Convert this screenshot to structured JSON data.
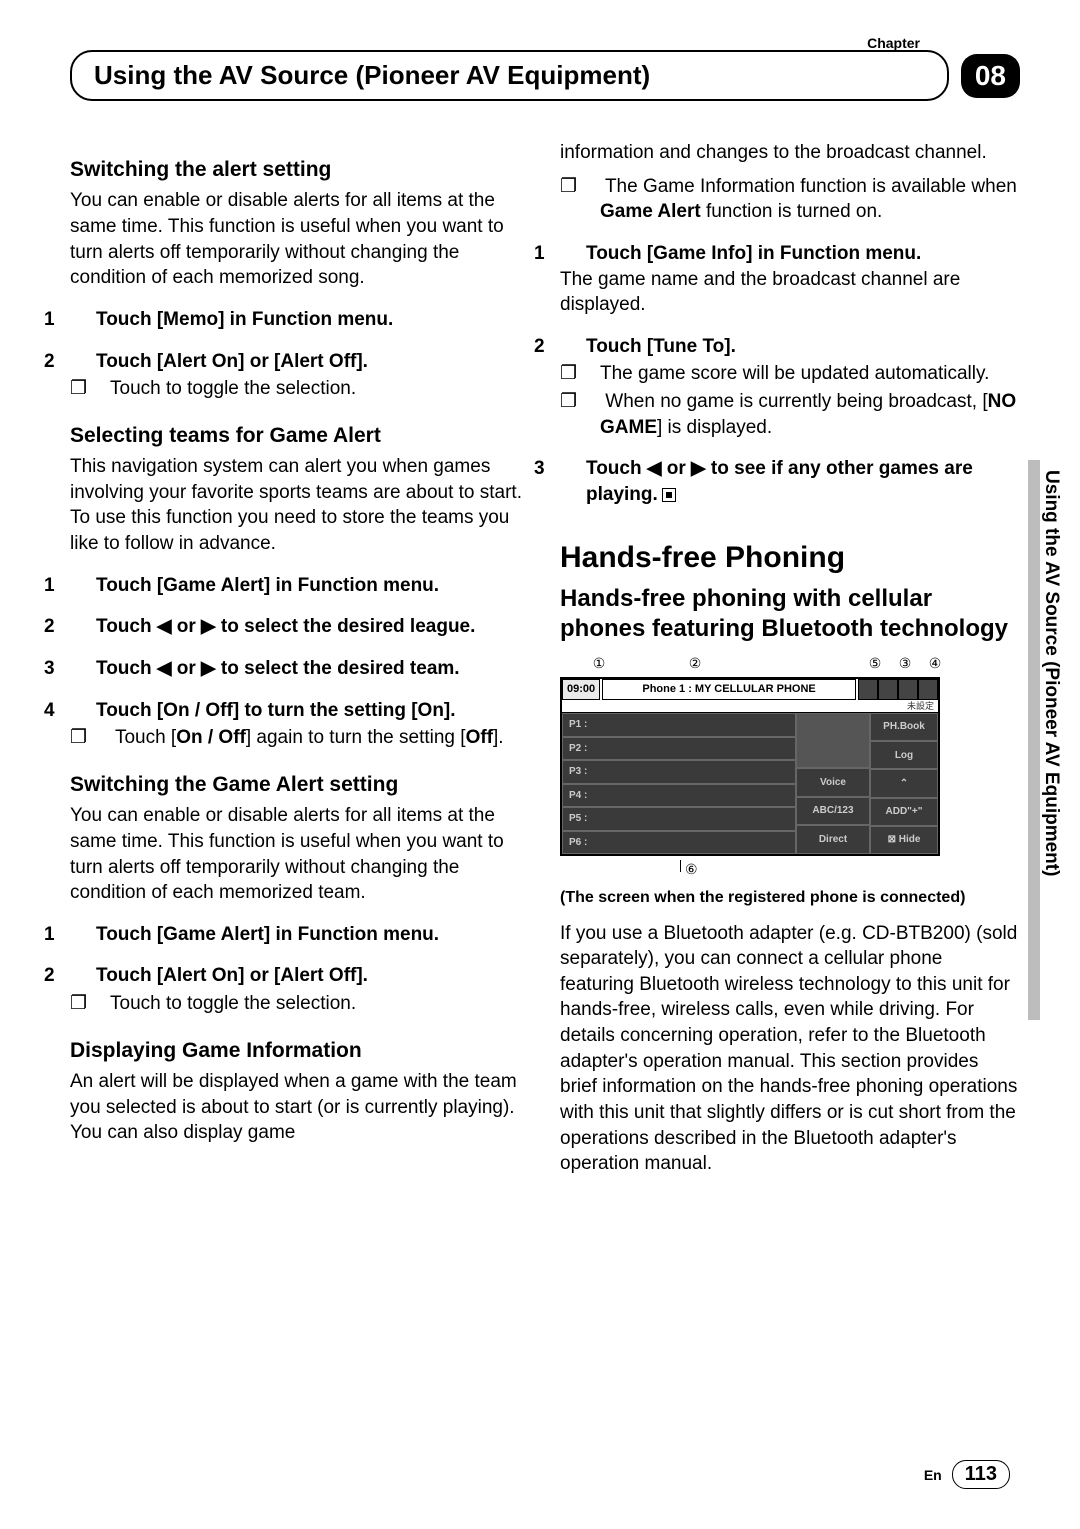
{
  "header": {
    "chapter_label": "Chapter",
    "title": "Using the AV Source (Pioneer AV Equipment)",
    "chapter_number": "08"
  },
  "left": {
    "s1_head": "Switching the alert setting",
    "s1_p": "You can enable or disable alerts for all items at the same time. This function is useful when you want to turn alerts off temporarily without changing the condition of each memorized song.",
    "s1_step1": "Touch [Memo] in Function menu.",
    "s1_step2": "Touch [Alert On] or [Alert Off].",
    "s1_note1": "Touch to toggle the selection.",
    "s2_head": "Selecting teams for Game Alert",
    "s2_p": "This navigation system can alert you when games involving your favorite sports teams are about to start. To use this function you need to store the teams you like to follow in advance.",
    "s2_step1": "Touch [Game Alert] in Function menu.",
    "s2_step2": "Touch ◀ or ▶ to select the desired league.",
    "s2_step3": "Touch ◀ or ▶ to select the desired team.",
    "s2_step4": "Touch [On / Off] to turn the setting [On].",
    "s2_note1a": "Touch [",
    "s2_note1b": "On / Off",
    "s2_note1c": "] again to turn the setting [",
    "s2_note1d": "Off",
    "s2_note1e": "].",
    "s3_head": "Switching the Game Alert setting",
    "s3_p": "You can enable or disable alerts for all items at the same time. This function is useful when you want to turn alerts off temporarily without changing the condition of each memorized team.",
    "s3_step1": "Touch [Game Alert] in Function menu.",
    "s3_step2": "Touch [Alert On] or [Alert Off].",
    "s3_note1": "Touch to toggle the selection.",
    "s4_head": "Displaying Game Information",
    "s4_p": "An alert will be displayed when a game with the team you selected is about to start (or is currently playing). You can also display game"
  },
  "right": {
    "cont": "information and changes to the broadcast channel.",
    "note0a": "The Game Information function is available when ",
    "note0b": "Game Alert",
    "note0c": " function is turned on.",
    "step1": "Touch [Game Info] in Function menu.",
    "step1_p": "The game name and the broadcast channel are displayed.",
    "step2": "Touch [Tune To].",
    "step2_n1": "The game score will be updated automatically.",
    "step2_n2a": "When no game is currently being broadcast, [",
    "step2_n2b": "NO GAME",
    "step2_n2c": "] is displayed.",
    "step3": "Touch ◀ or ▶ to see if any other games are playing.",
    "big": "Hands-free Phoning",
    "mid": "Hands-free phoning with cellular phones featuring Bluetooth technology",
    "callouts": {
      "c1": "①",
      "c2": "②",
      "c3": "③",
      "c4": "④",
      "c5": "⑤",
      "c6": "⑥"
    },
    "phone": {
      "clock": "09:00",
      "name": "Phone 1 : MY CELLULAR PHONE",
      "presets": [
        "P1 :",
        "P2 :",
        "P3 :",
        "P4 :",
        "P5 :",
        "P6 :"
      ],
      "mid": [
        "Voice",
        "ABC/123",
        "Direct"
      ],
      "rightbtns": [
        "PH.Book",
        "Log",
        "⌃",
        "ADD\"+\"",
        "⊠ Hide"
      ],
      "kanji": "未設定"
    },
    "caption": "(The screen when the registered phone is connected)",
    "body": "If you use a Bluetooth adapter (e.g. CD-BTB200) (sold separately), you can connect a cellular phone featuring Bluetooth wireless technology to this unit for hands-free, wireless calls, even while driving. For details concerning operation, refer to the Bluetooth adapter's operation manual. This section provides brief information on the hands-free phoning operations with this unit that slightly differs or is cut short from the operations described in the Bluetooth adapter's operation manual."
  },
  "side_tab": "Using the AV Source (Pioneer AV Equipment)",
  "footer": {
    "lang": "En",
    "page": "113"
  }
}
